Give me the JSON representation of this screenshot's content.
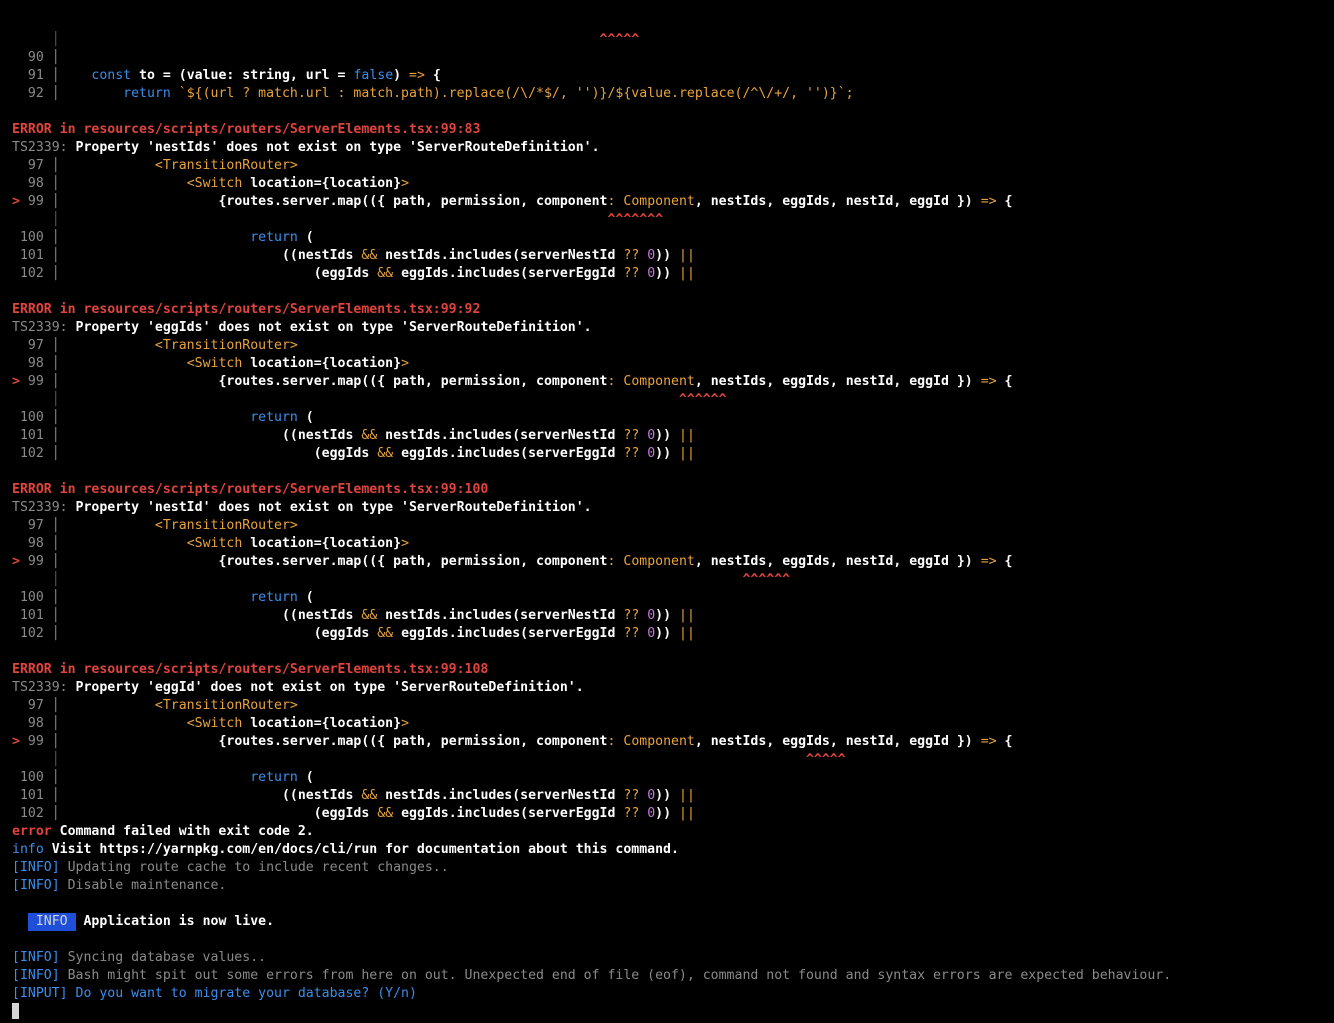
{
  "colors": {
    "d": "#d4d4d4",
    "w": "#ffffff",
    "r": "#e0443e",
    "o": "#e8a33c",
    "p": "#c678dd",
    "g": "#8a8a8a",
    "b": "#3b8eea",
    "bg_badge": "#1f4fd8",
    "dim": "#5a5a5a"
  },
  "terminal": {
    "lines": [
      [
        {
          "t": "     │                                                                    ",
          "c": "dim"
        },
        {
          "t": "^^^^^",
          "c": "r"
        }
      ],
      [
        {
          "t": "  90 │",
          "c": "g"
        }
      ],
      [
        {
          "t": "  91 │",
          "c": "g"
        },
        {
          "t": "    "
        },
        {
          "t": "const",
          "c": "b"
        },
        {
          "t": " to = (",
          "c": "w"
        },
        {
          "t": "value",
          "c": "w"
        },
        {
          "t": ": string, url = ",
          "c": "w"
        },
        {
          "t": "false",
          "c": "b"
        },
        {
          "t": ") ",
          "c": "w"
        },
        {
          "t": "=>",
          "c": "o"
        },
        {
          "t": " {",
          "c": "w"
        }
      ],
      [
        {
          "t": "  92 │",
          "c": "g"
        },
        {
          "t": "        "
        },
        {
          "t": "return",
          "c": "b"
        },
        {
          "t": " `${(url ? match.url : match.path).replace(/\\/*$/, '')}/${value.replace(/^\\/+/, '')}`;",
          "c": "o"
        }
      ],
      [
        {
          "t": ""
        }
      ],
      [
        {
          "t": "ERROR in resources/scripts/routers/ServerElements.tsx:99:83",
          "c": "r"
        }
      ],
      [
        {
          "t": "TS2339: ",
          "c": "g"
        },
        {
          "t": "Property 'nestIds' does not exist on type 'ServerRouteDefinition'.",
          "c": "w"
        }
      ],
      [
        {
          "t": "  97 │",
          "c": "g"
        },
        {
          "t": "            "
        },
        {
          "t": "<TransitionRouter>",
          "c": "o"
        }
      ],
      [
        {
          "t": "  98 │",
          "c": "g"
        },
        {
          "t": "                "
        },
        {
          "t": "<Switch",
          "c": "o"
        },
        {
          "t": " location={location}",
          "c": "w"
        },
        {
          "t": ">",
          "c": "o"
        }
      ],
      [
        {
          "t": "> ",
          "c": "r"
        },
        {
          "t": "99 │",
          "c": "g"
        },
        {
          "t": "                    {routes.server.map(({ path, permission, component",
          "c": "w"
        },
        {
          "t": ":",
          "c": "o"
        },
        {
          "t": " Component",
          "c": "o"
        },
        {
          "t": ", nestIds, eggIds, nestId, eggId }) ",
          "c": "w"
        },
        {
          "t": "=>",
          "c": "o"
        },
        {
          "t": " {",
          "c": "w"
        }
      ],
      [
        {
          "t": "     │                                                                     ",
          "c": "dim"
        },
        {
          "t": "^^^^^^^",
          "c": "r"
        }
      ],
      [
        {
          "t": " 100 │",
          "c": "g"
        },
        {
          "t": "                        "
        },
        {
          "t": "return",
          "c": "b"
        },
        {
          "t": " (",
          "c": "w"
        }
      ],
      [
        {
          "t": " 101 │",
          "c": "g"
        },
        {
          "t": "                            ((nestIds ",
          "c": "w"
        },
        {
          "t": "&&",
          "c": "o"
        },
        {
          "t": " nestIds.includes(serverNestId ",
          "c": "w"
        },
        {
          "t": "??",
          "c": "o"
        },
        {
          "t": " "
        },
        {
          "t": "0",
          "c": "p"
        },
        {
          "t": ")) ",
          "c": "w"
        },
        {
          "t": "||",
          "c": "o"
        }
      ],
      [
        {
          "t": " 102 │",
          "c": "g"
        },
        {
          "t": "                                (eggIds ",
          "c": "w"
        },
        {
          "t": "&&",
          "c": "o"
        },
        {
          "t": " eggIds.includes(serverEggId ",
          "c": "w"
        },
        {
          "t": "??",
          "c": "o"
        },
        {
          "t": " "
        },
        {
          "t": "0",
          "c": "p"
        },
        {
          "t": ")) ",
          "c": "w"
        },
        {
          "t": "||",
          "c": "o"
        }
      ],
      [
        {
          "t": ""
        }
      ],
      [
        {
          "t": "ERROR in resources/scripts/routers/ServerElements.tsx:99:92",
          "c": "r"
        }
      ],
      [
        {
          "t": "TS2339: ",
          "c": "g"
        },
        {
          "t": "Property 'eggIds' does not exist on type 'ServerRouteDefinition'.",
          "c": "w"
        }
      ],
      [
        {
          "t": "  97 │",
          "c": "g"
        },
        {
          "t": "            "
        },
        {
          "t": "<TransitionRouter>",
          "c": "o"
        }
      ],
      [
        {
          "t": "  98 │",
          "c": "g"
        },
        {
          "t": "                "
        },
        {
          "t": "<Switch",
          "c": "o"
        },
        {
          "t": " location={location}",
          "c": "w"
        },
        {
          "t": ">",
          "c": "o"
        }
      ],
      [
        {
          "t": "> ",
          "c": "r"
        },
        {
          "t": "99 │",
          "c": "g"
        },
        {
          "t": "                    {routes.server.map(({ path, permission, component",
          "c": "w"
        },
        {
          "t": ":",
          "c": "o"
        },
        {
          "t": " Component",
          "c": "o"
        },
        {
          "t": ", nestIds, eggIds, nestId, eggId }) ",
          "c": "w"
        },
        {
          "t": "=>",
          "c": "o"
        },
        {
          "t": " {",
          "c": "w"
        }
      ],
      [
        {
          "t": "     │                                                                              ",
          "c": "dim"
        },
        {
          "t": "^^^^^^",
          "c": "r"
        }
      ],
      [
        {
          "t": " 100 │",
          "c": "g"
        },
        {
          "t": "                        "
        },
        {
          "t": "return",
          "c": "b"
        },
        {
          "t": " (",
          "c": "w"
        }
      ],
      [
        {
          "t": " 101 │",
          "c": "g"
        },
        {
          "t": "                            ((nestIds ",
          "c": "w"
        },
        {
          "t": "&&",
          "c": "o"
        },
        {
          "t": " nestIds.includes(serverNestId ",
          "c": "w"
        },
        {
          "t": "??",
          "c": "o"
        },
        {
          "t": " "
        },
        {
          "t": "0",
          "c": "p"
        },
        {
          "t": ")) ",
          "c": "w"
        },
        {
          "t": "||",
          "c": "o"
        }
      ],
      [
        {
          "t": " 102 │",
          "c": "g"
        },
        {
          "t": "                                (eggIds ",
          "c": "w"
        },
        {
          "t": "&&",
          "c": "o"
        },
        {
          "t": " eggIds.includes(serverEggId ",
          "c": "w"
        },
        {
          "t": "??",
          "c": "o"
        },
        {
          "t": " "
        },
        {
          "t": "0",
          "c": "p"
        },
        {
          "t": ")) ",
          "c": "w"
        },
        {
          "t": "||",
          "c": "o"
        }
      ],
      [
        {
          "t": ""
        }
      ],
      [
        {
          "t": "ERROR in resources/scripts/routers/ServerElements.tsx:99:100",
          "c": "r"
        }
      ],
      [
        {
          "t": "TS2339: ",
          "c": "g"
        },
        {
          "t": "Property 'nestId' does not exist on type 'ServerRouteDefinition'.",
          "c": "w"
        }
      ],
      [
        {
          "t": "  97 │",
          "c": "g"
        },
        {
          "t": "            "
        },
        {
          "t": "<TransitionRouter>",
          "c": "o"
        }
      ],
      [
        {
          "t": "  98 │",
          "c": "g"
        },
        {
          "t": "                "
        },
        {
          "t": "<Switch",
          "c": "o"
        },
        {
          "t": " location={location}",
          "c": "w"
        },
        {
          "t": ">",
          "c": "o"
        }
      ],
      [
        {
          "t": "> ",
          "c": "r"
        },
        {
          "t": "99 │",
          "c": "g"
        },
        {
          "t": "                    {routes.server.map(({ path, permission, component",
          "c": "w"
        },
        {
          "t": ":",
          "c": "o"
        },
        {
          "t": " Component",
          "c": "o"
        },
        {
          "t": ", nestIds, eggIds, nestId, eggId }) ",
          "c": "w"
        },
        {
          "t": "=>",
          "c": "o"
        },
        {
          "t": " {",
          "c": "w"
        }
      ],
      [
        {
          "t": "     │                                                                                      ",
          "c": "dim"
        },
        {
          "t": "^^^^^^",
          "c": "r"
        }
      ],
      [
        {
          "t": " 100 │",
          "c": "g"
        },
        {
          "t": "                        "
        },
        {
          "t": "return",
          "c": "b"
        },
        {
          "t": " (",
          "c": "w"
        }
      ],
      [
        {
          "t": " 101 │",
          "c": "g"
        },
        {
          "t": "                            ((nestIds ",
          "c": "w"
        },
        {
          "t": "&&",
          "c": "o"
        },
        {
          "t": " nestIds.includes(serverNestId ",
          "c": "w"
        },
        {
          "t": "??",
          "c": "o"
        },
        {
          "t": " "
        },
        {
          "t": "0",
          "c": "p"
        },
        {
          "t": ")) ",
          "c": "w"
        },
        {
          "t": "||",
          "c": "o"
        }
      ],
      [
        {
          "t": " 102 │",
          "c": "g"
        },
        {
          "t": "                                (eggIds ",
          "c": "w"
        },
        {
          "t": "&&",
          "c": "o"
        },
        {
          "t": " eggIds.includes(serverEggId ",
          "c": "w"
        },
        {
          "t": "??",
          "c": "o"
        },
        {
          "t": " "
        },
        {
          "t": "0",
          "c": "p"
        },
        {
          "t": ")) ",
          "c": "w"
        },
        {
          "t": "||",
          "c": "o"
        }
      ],
      [
        {
          "t": ""
        }
      ],
      [
        {
          "t": "ERROR in resources/scripts/routers/ServerElements.tsx:99:108",
          "c": "r"
        }
      ],
      [
        {
          "t": "TS2339: ",
          "c": "g"
        },
        {
          "t": "Property 'eggId' does not exist on type 'ServerRouteDefinition'.",
          "c": "w"
        }
      ],
      [
        {
          "t": "  97 │",
          "c": "g"
        },
        {
          "t": "            "
        },
        {
          "t": "<TransitionRouter>",
          "c": "o"
        }
      ],
      [
        {
          "t": "  98 │",
          "c": "g"
        },
        {
          "t": "                "
        },
        {
          "t": "<Switch",
          "c": "o"
        },
        {
          "t": " location={location}",
          "c": "w"
        },
        {
          "t": ">",
          "c": "o"
        }
      ],
      [
        {
          "t": "> ",
          "c": "r"
        },
        {
          "t": "99 │",
          "c": "g"
        },
        {
          "t": "                    {routes.server.map(({ path, permission, component",
          "c": "w"
        },
        {
          "t": ":",
          "c": "o"
        },
        {
          "t": " Component",
          "c": "o"
        },
        {
          "t": ", nestIds, eggIds, nestId, eggId }) ",
          "c": "w"
        },
        {
          "t": "=>",
          "c": "o"
        },
        {
          "t": " {",
          "c": "w"
        }
      ],
      [
        {
          "t": "     │                                                                                              ",
          "c": "dim"
        },
        {
          "t": "^^^^^",
          "c": "r"
        }
      ],
      [
        {
          "t": " 100 │",
          "c": "g"
        },
        {
          "t": "                        "
        },
        {
          "t": "return",
          "c": "b"
        },
        {
          "t": " (",
          "c": "w"
        }
      ],
      [
        {
          "t": " 101 │",
          "c": "g"
        },
        {
          "t": "                            ((nestIds ",
          "c": "w"
        },
        {
          "t": "&&",
          "c": "o"
        },
        {
          "t": " nestIds.includes(serverNestId ",
          "c": "w"
        },
        {
          "t": "??",
          "c": "o"
        },
        {
          "t": " "
        },
        {
          "t": "0",
          "c": "p"
        },
        {
          "t": ")) ",
          "c": "w"
        },
        {
          "t": "||",
          "c": "o"
        }
      ],
      [
        {
          "t": " 102 │",
          "c": "g"
        },
        {
          "t": "                                (eggIds ",
          "c": "w"
        },
        {
          "t": "&&",
          "c": "o"
        },
        {
          "t": " eggIds.includes(serverEggId ",
          "c": "w"
        },
        {
          "t": "??",
          "c": "o"
        },
        {
          "t": " "
        },
        {
          "t": "0",
          "c": "p"
        },
        {
          "t": ")) ",
          "c": "w"
        },
        {
          "t": "||",
          "c": "o"
        }
      ],
      [
        {
          "t": "error",
          "c": "r"
        },
        {
          "t": " Command failed with exit code 2.",
          "c": "w"
        }
      ],
      [
        {
          "t": "info",
          "c": "b"
        },
        {
          "t": " Visit ",
          "c": "w"
        },
        {
          "t": "https://yarnpkg.com/en/docs/cli/run",
          "c": "w"
        },
        {
          "t": " for documentation about this command.",
          "c": "w"
        }
      ],
      [
        {
          "t": "[INFO]",
          "c": "b"
        },
        {
          "t": " Updating route cache to include recent changes..",
          "c": "g"
        }
      ],
      [
        {
          "t": "[INFO]",
          "c": "b"
        },
        {
          "t": " Disable maintenance.",
          "c": "g"
        }
      ],
      [
        {
          "t": ""
        }
      ],
      [
        {
          "t": "  "
        },
        {
          "t": " INFO ",
          "c": "badge"
        },
        {
          "t": " Application is now live.",
          "c": "w"
        }
      ],
      [
        {
          "t": ""
        }
      ],
      [
        {
          "t": "[INFO]",
          "c": "b"
        },
        {
          "t": " Syncing database values..",
          "c": "g"
        }
      ],
      [
        {
          "t": "[INFO]",
          "c": "b"
        },
        {
          "t": " Bash might spit out some errors from here on out. Unexpected end of file (eof), command not found and syntax errors are expected behaviour.",
          "c": "g"
        }
      ],
      [
        {
          "t": "[INPUT] Do you want to migrate your database? (Y/n)",
          "c": "b"
        }
      ]
    ]
  }
}
